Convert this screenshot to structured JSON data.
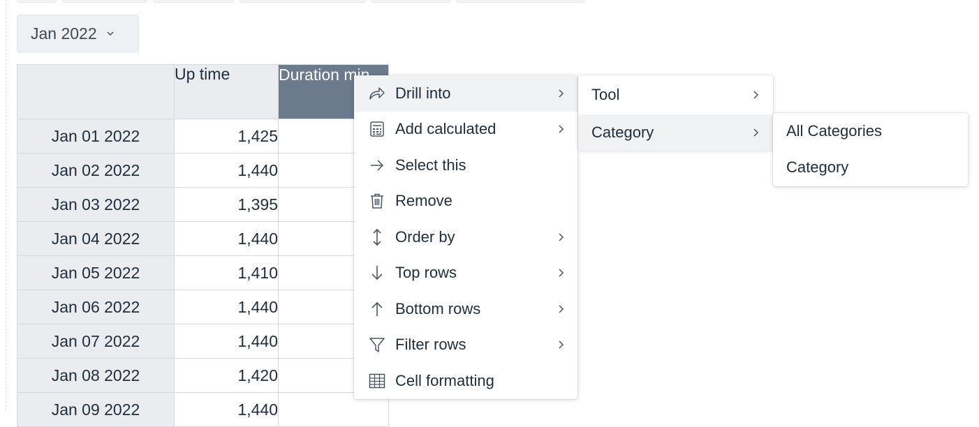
{
  "period_selector": {
    "label": "Jan 2022"
  },
  "grid": {
    "headers": {
      "up_time": "Up time",
      "duration": "Duration min"
    },
    "rows": [
      {
        "date": "Jan 01 2022",
        "up_time": "1,425"
      },
      {
        "date": "Jan 02 2022",
        "up_time": "1,440"
      },
      {
        "date": "Jan 03 2022",
        "up_time": "1,395"
      },
      {
        "date": "Jan 04 2022",
        "up_time": "1,440"
      },
      {
        "date": "Jan 05 2022",
        "up_time": "1,410"
      },
      {
        "date": "Jan 06 2022",
        "up_time": "1,440"
      },
      {
        "date": "Jan 07 2022",
        "up_time": "1,440"
      },
      {
        "date": "Jan 08 2022",
        "up_time": "1,420"
      },
      {
        "date": "Jan 09 2022",
        "up_time": "1,440"
      }
    ]
  },
  "context_menu": {
    "items": [
      {
        "label": "Drill into",
        "icon": "share-arrow-icon",
        "submenu": true
      },
      {
        "label": "Add calculated",
        "icon": "calculator-icon",
        "submenu": true
      },
      {
        "label": "Select this",
        "icon": "arrow-right-icon",
        "submenu": false
      },
      {
        "label": "Remove",
        "icon": "trash-icon",
        "submenu": false
      },
      {
        "label": "Order by",
        "icon": "sort-vertical-icon",
        "submenu": true
      },
      {
        "label": "Top rows",
        "icon": "arrow-down-icon",
        "submenu": true
      },
      {
        "label": "Bottom rows",
        "icon": "arrow-up-icon",
        "submenu": true
      },
      {
        "label": "Filter rows",
        "icon": "filter-icon",
        "submenu": true
      },
      {
        "label": "Cell formatting",
        "icon": "table-icon",
        "submenu": false
      }
    ]
  },
  "drill_submenu": {
    "items": [
      {
        "label": "Tool"
      },
      {
        "label": "Category"
      }
    ]
  },
  "category_submenu": {
    "items": [
      {
        "label": "All Categories"
      },
      {
        "label": "Category"
      }
    ]
  },
  "colors": {
    "header_active": "#6b7a8c",
    "header_bg": "#eaecef",
    "text": "#1f2d3d",
    "menu_hover": "#f0f2f4"
  }
}
